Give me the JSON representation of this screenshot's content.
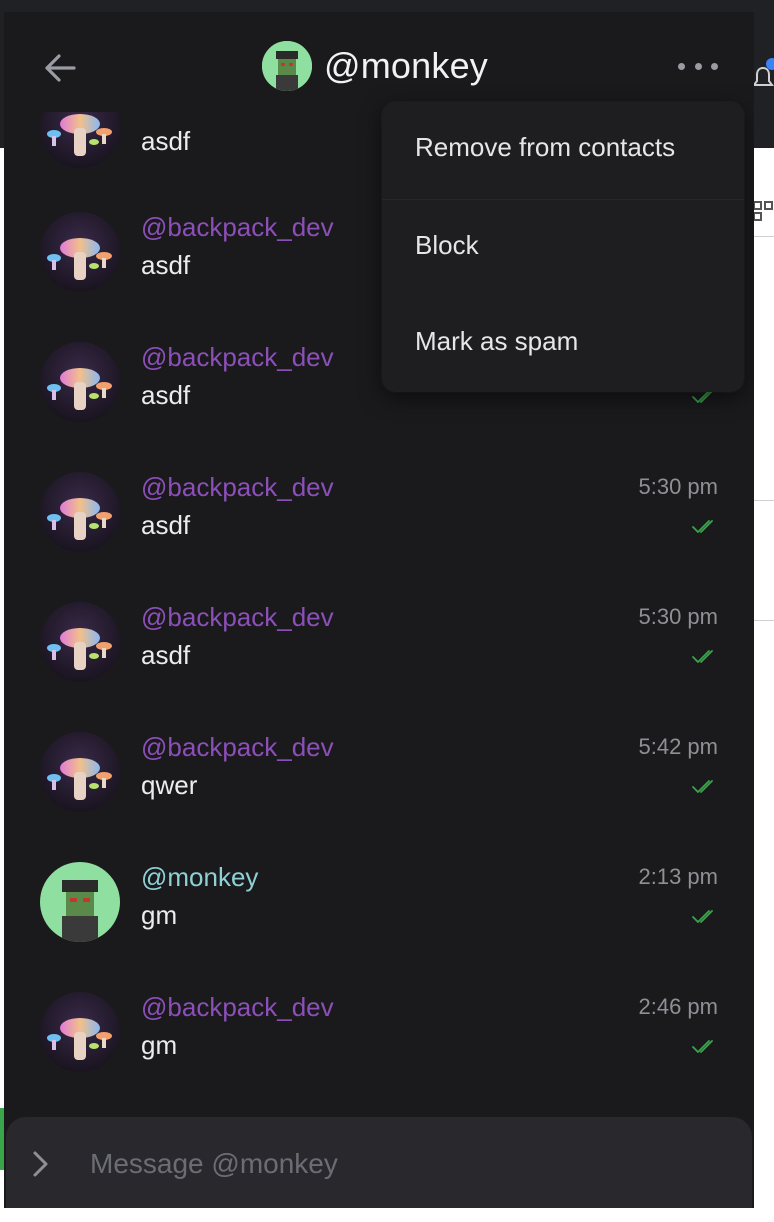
{
  "header": {
    "title": "@monkey"
  },
  "menu": {
    "items": [
      {
        "label": "Remove from contacts"
      },
      {
        "label": "Block"
      },
      {
        "label": "Mark as spam"
      }
    ]
  },
  "messages": [
    {
      "name": "",
      "text": "asdf",
      "time": "",
      "avatar": "mushroom"
    },
    {
      "name": "@backpack_dev",
      "text": "asdf",
      "time": "",
      "avatar": "mushroom"
    },
    {
      "name": "@backpack_dev",
      "text": "asdf",
      "time": "",
      "avatar": "mushroom"
    },
    {
      "name": "@backpack_dev",
      "text": "asdf",
      "time": "5:30 pm",
      "avatar": "mushroom"
    },
    {
      "name": "@backpack_dev",
      "text": "asdf",
      "time": "5:30 pm",
      "avatar": "mushroom"
    },
    {
      "name": "@backpack_dev",
      "text": "qwer",
      "time": "5:42 pm",
      "avatar": "mushroom"
    },
    {
      "name": "@monkey",
      "text": "gm",
      "time": "2:13 pm",
      "avatar": "monkey"
    },
    {
      "name": "@backpack_dev",
      "text": "gm",
      "time": "2:46 pm",
      "avatar": "mushroom"
    }
  ],
  "composer": {
    "placeholder": "Message @monkey",
    "value": ""
  },
  "colors": {
    "backpack_name": "#8c4fb8",
    "monkey_name": "#8fd0d4",
    "read_check": "#3aa54b",
    "panel_bg": "#1a1a1d"
  },
  "icons": {
    "back": "arrow-left-icon",
    "more": "more-horizontal-icon",
    "send": "chevron-right-icon",
    "read": "double-check-icon"
  }
}
